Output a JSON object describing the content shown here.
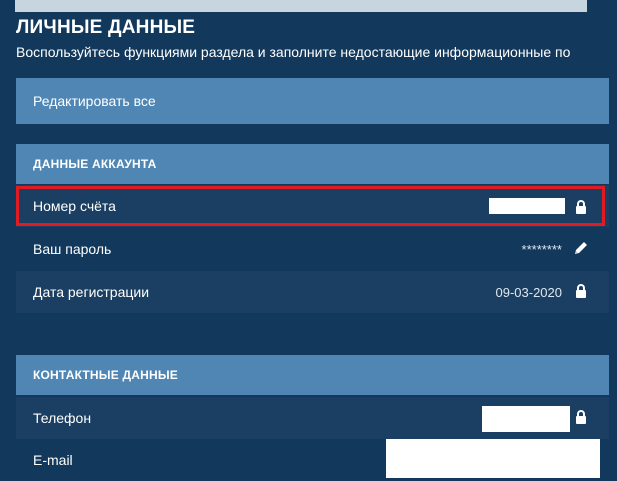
{
  "page": {
    "title": "ЛИЧНЫЕ ДАННЫЕ",
    "subtitle": "Воспользуйтесь функциями раздела и заполните недостающие информационные по"
  },
  "edit_all": {
    "label": "Редактировать все"
  },
  "account": {
    "header": "ДАННЫЕ АККАУНТА",
    "rows": [
      {
        "label": "Номер счёта",
        "value": "",
        "icon": "lock-icon"
      },
      {
        "label": "Ваш пароль",
        "value": "********",
        "icon": "pencil-icon"
      },
      {
        "label": "Дата регистрации",
        "value": "09-03-2020",
        "icon": "lock-icon"
      }
    ]
  },
  "contacts": {
    "header": "КОНТАКТНЫЕ ДАННЫЕ",
    "rows": [
      {
        "label": "Телефон",
        "value": "",
        "icon": "lock-icon"
      },
      {
        "label": "E-mail",
        "value": ""
      }
    ]
  },
  "colors": {
    "page_bg": "#12385c",
    "bar_blue": "#4f86b4",
    "row_shaded": "#1a3f62",
    "highlight_red": "#e11b22"
  }
}
